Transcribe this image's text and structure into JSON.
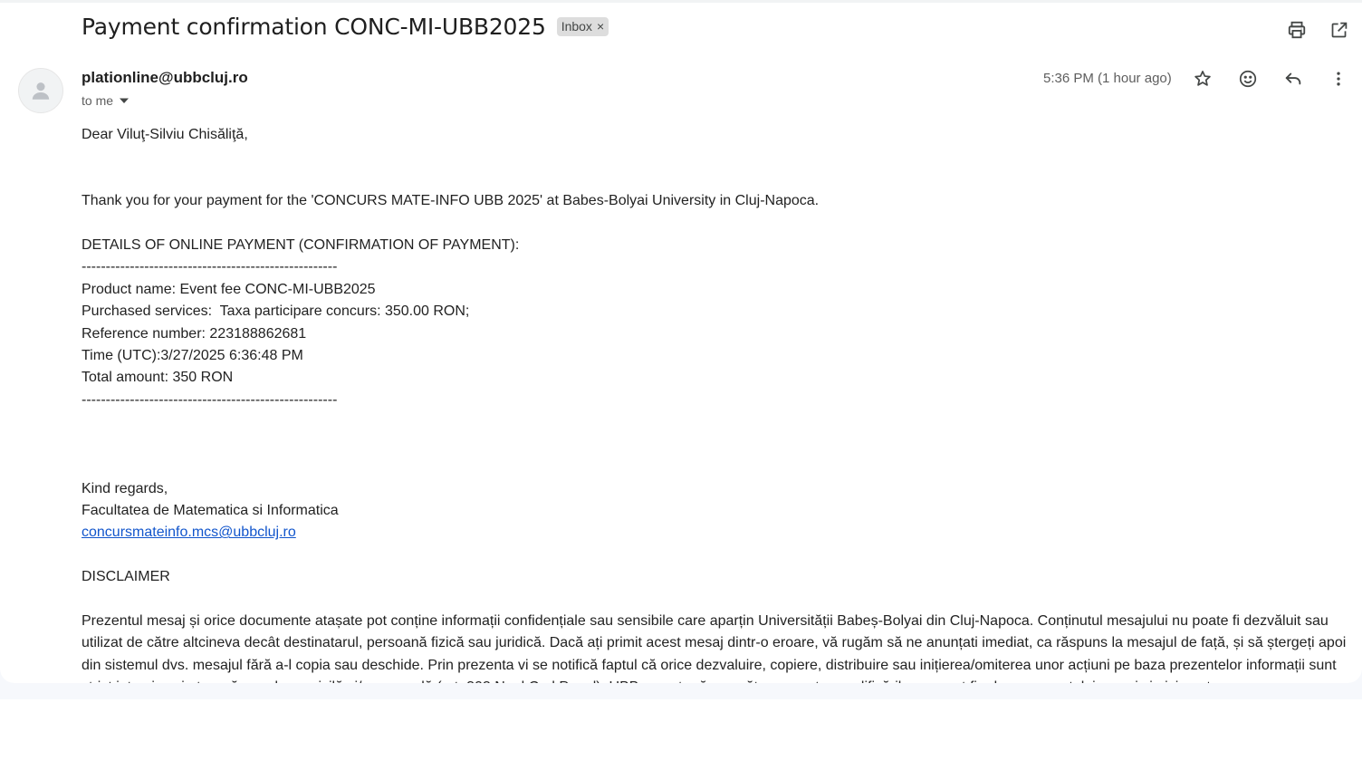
{
  "header": {
    "subject": "Payment confirmation CONC-MI-UBB2025",
    "label": "Inbox",
    "label_remove": "×"
  },
  "icons": {
    "print": "print-icon",
    "open_new_window": "open-in-new-window-icon",
    "star": "star-icon",
    "emoji": "emoji-icon",
    "reply": "reply-icon",
    "more": "more-vert-icon",
    "avatar": "person-icon",
    "caret": "caret-down-icon"
  },
  "message": {
    "sender": "plationline@ubbcluj.ro",
    "recipient": "to me",
    "time": "5:36 PM (1 hour ago)",
    "greeting": "Dear Viluţ-Silviu Chisăliţă,",
    "thanks": "Thank you for your payment for the 'CONCURS MATE-INFO UBB 2025' at Babes-Bolyai University in Cluj-Napoca.",
    "details_title": "DETAILS OF ONLINE PAYMENT (CONFIRMATION OF PAYMENT):",
    "separator": "-----------------------------------------------------",
    "product": "Product name: Event fee CONC-MI-UBB2025",
    "services": "Purchased services:  Taxa participare concurs: 350.00 RON;",
    "reference": "Reference number: 223188862681",
    "time_utc": "Time (UTC):3/27/2025 6:36:48 PM",
    "total": "Total amount: 350 RON",
    "regards": "Kind regards,",
    "faculty": "Facultatea de Matematica si Informatica",
    "email_link": "concursmateinfo.mcs@ubbcluj.ro",
    "disclaimer_title": "DISCLAIMER",
    "disclaimer_text": "Prezentul mesaj și orice documente atașate pot conține informații confidențiale sau sensibile care aparțin Universității Babeș-Bolyai din Cluj-Napoca. Conținutul mesajului nu poate fi dezvăluit sau utilizat de către altcineva decât destinatarul, persoană fizică sau juridică. Dacă ați primit acest mesaj dintr-o eroare, vă rugăm să ne anunțati imediat, ca răspuns la mesajul de față, și să ștergeți apoi din sistemul dvs. mesajul fără a-l copia sau deschide. Prin prezenta vi se notifică faptul că orice dezvaluire, copiere, distribuire sau inițierea/omiterea unor acțiuni pe baza prezentelor informații sunt strict interzise și atrag răspunderea civilă și/sau penală (art. 302 Noul Cod Penal). UBB nu este răspunzătoare pentru modificările care pot fi aduse prezentului mesaj și nici pentru"
  }
}
